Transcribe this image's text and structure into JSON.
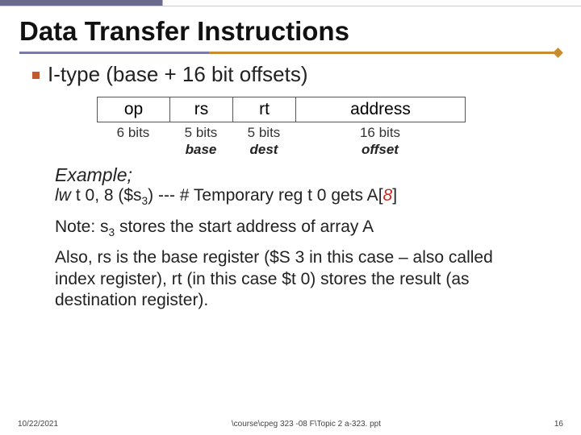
{
  "title": "Data Transfer Instructions",
  "bullet": "I-type (base + 16 bit offsets)",
  "fields": {
    "op": "op",
    "rs": "rs",
    "rt": "rt",
    "addr": "address"
  },
  "bits": {
    "op": "6 bits",
    "rs": "5 bits",
    "rt": "5 bits",
    "addr": "16 bits"
  },
  "roles": {
    "op": "",
    "rs": "base",
    "rt": "dest",
    "addr": "offset"
  },
  "example": {
    "header": "Example;",
    "mnemonic": "lw",
    "p1": "t 0, 8 ($s",
    "sub1": "3",
    "p2": ") ---  # Temporary reg  t 0  gets A[",
    "idx": "8",
    "p3": "]"
  },
  "note1a": "Note:  s",
  "note1_sub": "3",
  "note1b": " stores the start address of array A",
  "note2": "Also, rs is the base register ($S 3 in this case – also called index register), rt  (in this case $t 0) stores the result (as destination register).",
  "footer": {
    "date": "10/22/2021",
    "path": "\\course\\cpeg 323 -08 F\\Topic 2 a-323. ppt",
    "page": "16"
  }
}
